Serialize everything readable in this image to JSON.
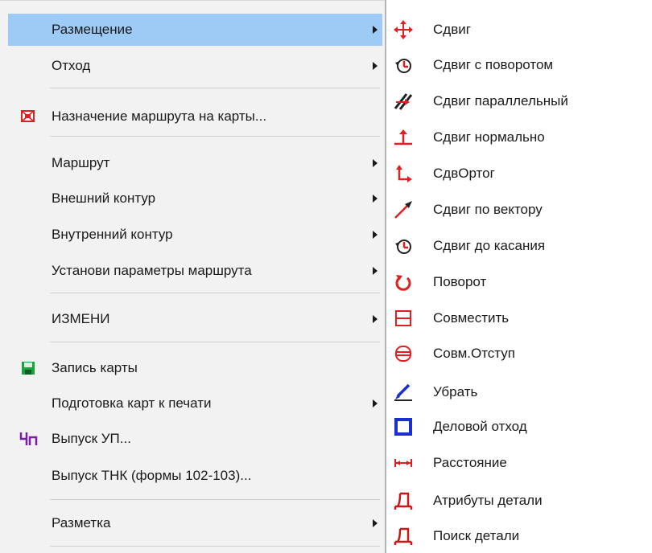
{
  "main_menu": {
    "placement": "Размещение",
    "waste": "Отход",
    "assign_route": "Назначение маршрута на карты...",
    "route": "Маршрут",
    "outer_contour": "Внешний контур",
    "inner_contour": "Внутренний контур",
    "route_params": "Установи параметры маршрута",
    "modify": "ИЗМЕНИ",
    "save_map": "Запись карты",
    "prepare_print": "Подготовка карт к печати",
    "issue_up": "Выпуск УП...",
    "issue_tnk": "Выпуск ТНК (формы 102-103)...",
    "marking": "Разметка"
  },
  "submenu": {
    "move": "Сдвиг",
    "move_rotate": "Сдвиг с поворотом",
    "move_parallel": "Сдвиг параллельный",
    "move_normal": "Сдвиг нормально",
    "move_ortho": "СдвОртог",
    "move_vector": "Сдвиг по вектору",
    "move_touch": "Сдвиг до касания",
    "rotate": "Поворот",
    "align": "Совместить",
    "align_offset": "Совм.Отступ",
    "remove": "Убрать",
    "business_waste": "Деловой отход",
    "distance": "Расстояние",
    "part_attributes": "Атрибуты детали",
    "find_part": "Поиск детали"
  },
  "colors": {
    "highlight": "#9ecbf5",
    "icon_red": "#e02020",
    "icon_blue": "#1a2fd0",
    "icon_green": "#19a33a",
    "icon_purple": "#7a1fa0"
  }
}
